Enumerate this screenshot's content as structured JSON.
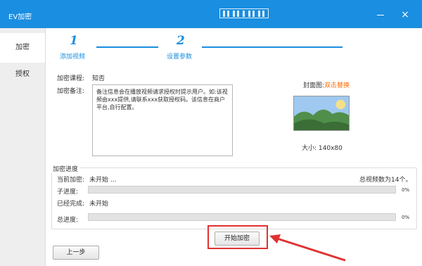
{
  "window": {
    "title": "EV加密"
  },
  "sidebar": {
    "items": [
      {
        "label": "加密"
      },
      {
        "label": "授权"
      }
    ]
  },
  "steps": [
    {
      "number": "1",
      "label": "添加视频"
    },
    {
      "number": "2",
      "label": "设置参数"
    }
  ],
  "form": {
    "course_label": "加密课程:",
    "course_value": "知否",
    "note_label": "加密备注:",
    "note_text": "备注信息会在播放视频请求授权时提示用户。如:该视频由xxx提供,请联系xxx获取授权码。该信息在商户平台,自行配置。"
  },
  "cover": {
    "label": "封面图:",
    "link": "双击替换",
    "size_label": "大小:",
    "size_value": "140x80"
  },
  "progress": {
    "title": "加密进度",
    "current_label": "当前加密:",
    "current_value": "未开始 ...",
    "total_videos": "总视频数为14个。",
    "sub_label": "子进度:",
    "sub_percent": "0%",
    "sub_value": 0,
    "done_label": "已经完成:",
    "done_value": "未开始",
    "total_label": "总进度:",
    "total_percent": "0%",
    "total_value": 0
  },
  "buttons": {
    "start": "开始加密",
    "prev": "上一步"
  },
  "colors": {
    "accent": "#1a8ee0",
    "link": "#ff6a00",
    "highlight": "#e03131"
  }
}
